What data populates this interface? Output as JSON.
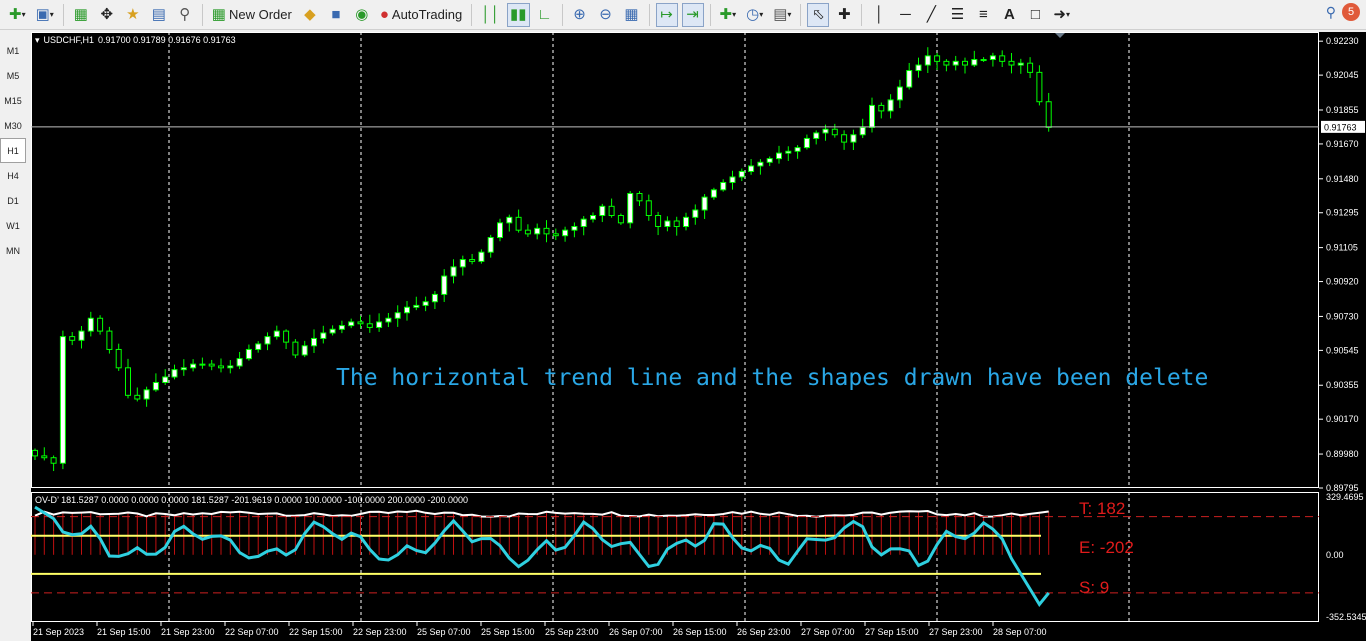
{
  "toolbar": {
    "new_order": "New Order",
    "auto_trading": "AutoTrading",
    "notifications": "5"
  },
  "timeframes": [
    "M1",
    "M5",
    "M15",
    "M30",
    "H1",
    "H4",
    "D1",
    "W1",
    "MN"
  ],
  "active_timeframe": "H1",
  "chart": {
    "symbol": "USDCHF,H1",
    "ohlc": "0.91700 0.91789 0.91676 0.91763",
    "current_price": "0.91763",
    "price_ticks": [
      "0.92230",
      "0.92045",
      "0.91855",
      "0.91670",
      "0.91480",
      "0.91295",
      "0.91105",
      "0.90920",
      "0.90730",
      "0.90545",
      "0.90355",
      "0.90170",
      "0.89980",
      "0.89795"
    ],
    "time_ticks": [
      "21 Sep 2023",
      "21 Sep 15:00",
      "21 Sep 23:00",
      "22 Sep 07:00",
      "22 Sep 15:00",
      "22 Sep 23:00",
      "25 Sep 07:00",
      "25 Sep 15:00",
      "25 Sep 23:00",
      "26 Sep 07:00",
      "26 Sep 15:00",
      "26 Sep 23:00",
      "27 Sep 07:00",
      "27 Sep 15:00",
      "27 Sep 23:00",
      "28 Sep 07:00"
    ],
    "note": "The horizontal trend line and the shapes drawn have been delete",
    "colors": {
      "bg": "#000000",
      "candle": "#00ff00",
      "bull_body": "#ffffff",
      "note": "#2aa7e6",
      "grid": "#ffffff"
    }
  },
  "indicator": {
    "title": "OV-D’ 181.5287 0.0000 0.0000 0.0000 181.5287 -201.9619 0.0000 100.0000 -100.0000 200.0000 -200.0000",
    "axis_top": "329.4695",
    "axis_zero": "0.00",
    "axis_bottom": "-352.5345",
    "stats": {
      "t": "T: 182",
      "e": "E: -202",
      "s": "S: 9"
    },
    "colors": {
      "line": "#2fd0e0",
      "bars": "#c01010",
      "level": "#ffff66",
      "envelope": "#ffffff",
      "dash": "#cc2020"
    }
  },
  "chart_data": {
    "type": "line",
    "title": "",
    "series": [
      {
        "name": "USDCHF,H1",
        "values": [
          0.8997,
          0.8996,
          0.8993,
          0.9062,
          0.906,
          0.9065,
          0.9072,
          0.9065,
          0.9055,
          0.9045,
          0.903,
          0.9028,
          0.9033,
          0.9037,
          0.904,
          0.9044,
          0.9045,
          0.9047,
          0.9047,
          0.9046,
          0.9045,
          0.9046,
          0.905,
          0.9055,
          0.9058,
          0.9062,
          0.9065,
          0.9059,
          0.9052,
          0.9057,
          0.9061,
          0.9064,
          0.9066,
          0.9068,
          0.907,
          0.9069,
          0.9067,
          0.907,
          0.9072,
          0.9075,
          0.9078,
          0.9079,
          0.9081,
          0.9085,
          0.9095,
          0.91,
          0.9104,
          0.9103,
          0.9108,
          0.9116,
          0.9124,
          0.9127,
          0.912,
          0.9118,
          0.9121,
          0.9118,
          0.9117,
          0.912,
          0.9122,
          0.9126,
          0.9128,
          0.9133,
          0.9128,
          0.9124,
          0.914,
          0.9136,
          0.9128,
          0.9122,
          0.9125,
          0.9122,
          0.9127,
          0.9131,
          0.9138,
          0.9142,
          0.9146,
          0.9149,
          0.9152,
          0.9155,
          0.9157,
          0.9159,
          0.9162,
          0.9163,
          0.9165,
          0.917,
          0.9173,
          0.9175,
          0.9172,
          0.9168,
          0.9172,
          0.9176,
          0.9188,
          0.9185,
          0.9191,
          0.9198,
          0.9207,
          0.921,
          0.9215,
          0.9212,
          0.921,
          0.9212,
          0.921,
          0.9213,
          0.9213,
          0.9215,
          0.9212,
          0.921,
          0.9211,
          0.9206,
          0.919,
          0.9176
        ]
      }
    ],
    "ylim": [
      0.89795,
      0.9228
    ],
    "grid": true
  }
}
